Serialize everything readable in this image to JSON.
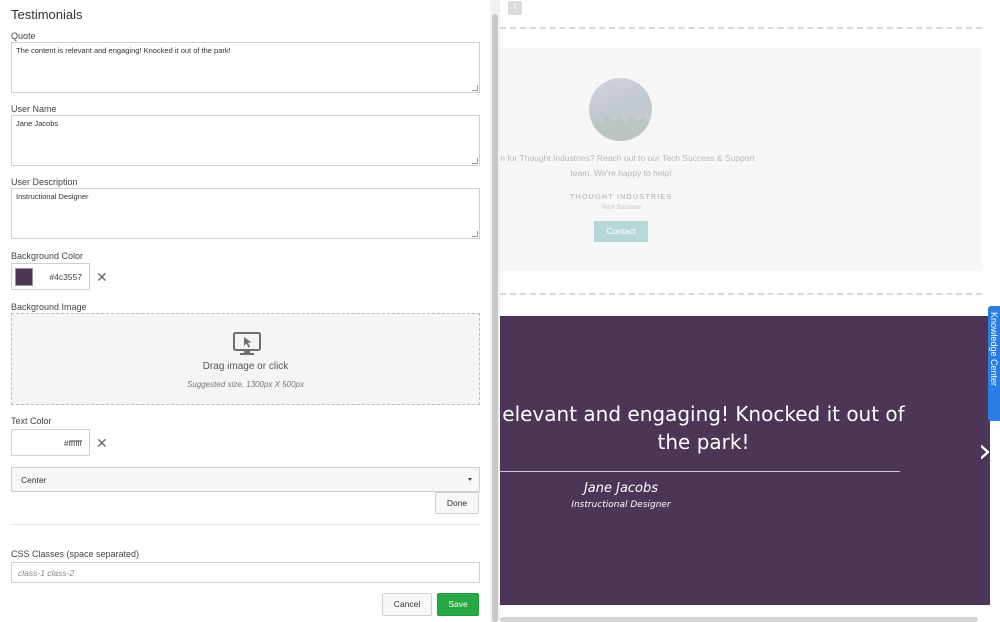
{
  "panel": {
    "title": "Testimonials",
    "quote": {
      "label": "Quote",
      "value": "The content is relevant and engaging! Knocked it out of the park!"
    },
    "user_name": {
      "label": "User Name",
      "value": "Jane Jacobs"
    },
    "user_description": {
      "label": "User Description",
      "value": "Instructional Designer"
    },
    "background_color": {
      "label": "Background Color",
      "value": "#4c3557",
      "swatch": "#4c3557",
      "clear_icon": "close-icon"
    },
    "background_image": {
      "label": "Background Image",
      "icon": "monitor-cursor-icon",
      "drop_text": "Drag image or click",
      "hint": "Suggested size, 1300px X 500px"
    },
    "text_color": {
      "label": "Text Color",
      "value": "#ffffff",
      "clear_icon": "close-icon"
    },
    "alignment": {
      "selected": "Center"
    },
    "done_label": "Done",
    "css_classes": {
      "label": "CSS Classes (space separated)",
      "placeholder": "class-1 class-2"
    },
    "cancel_label": "Cancel",
    "save_label": "Save"
  },
  "preview": {
    "card": {
      "line1": "stion for Thought Industries? Reach out to our Tech Success & Support",
      "line2": "team. We're happy to help!",
      "company": "THOUGHT INDUSTRIES",
      "role": "Tech Success",
      "button": "Contact"
    },
    "banner": {
      "background": "#4c3557",
      "quote": "elevant and engaging! Knocked it out of the park!",
      "name": "Jane Jacobs",
      "description": "Instructional Designer",
      "next_icon": "chevron-right-icon"
    },
    "side_tab": "Knowledge Center"
  }
}
